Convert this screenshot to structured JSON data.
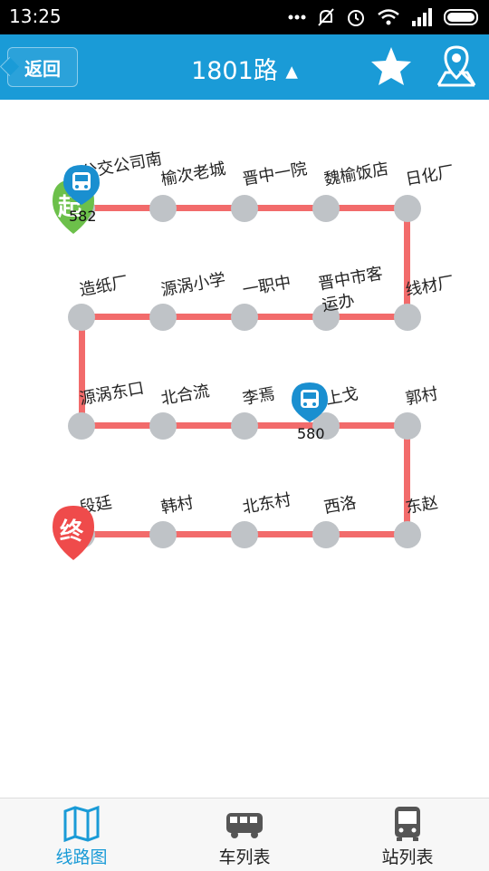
{
  "status_bar": {
    "time": "13:25"
  },
  "header": {
    "back_label": "返回",
    "title": "1801路 ▴"
  },
  "route": {
    "stops": [
      "公交公司南",
      "榆次老城",
      "晋中一院",
      "魏榆饭店",
      "日化厂",
      "线材厂",
      "晋中市客运办",
      "一职中",
      "源涡小学",
      "造纸厂",
      "源涡东口",
      "北合流",
      "李焉",
      "上戈",
      "郭村",
      "东赵",
      "西洛",
      "北东村",
      "韩村",
      "段廷"
    ],
    "start_marker": "起",
    "end_marker": "终",
    "buses": [
      {
        "number": "582"
      },
      {
        "number": "580"
      }
    ]
  },
  "tabs": [
    {
      "label": "线路图"
    },
    {
      "label": "车列表"
    },
    {
      "label": "站列表"
    }
  ],
  "colors": {
    "accent": "#1a9bd7",
    "route_line": "#f26b6b",
    "stop": "#bfc3c7",
    "start_pin": "#6cc04a",
    "end_pin": "#ef4b4b"
  }
}
